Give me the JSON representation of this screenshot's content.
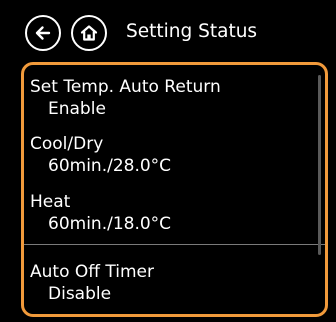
{
  "header": {
    "title": "Setting Status",
    "back_icon": "arrow-left-icon",
    "home_icon": "home-icon"
  },
  "colors": {
    "accent": "#f19a3b",
    "background": "#000000",
    "text": "#ffffff"
  },
  "settings": [
    {
      "label": "Set Temp. Auto Return",
      "value": "Enable"
    },
    {
      "label": "Cool/Dry",
      "value": "60min./28.0°C"
    },
    {
      "label": "Heat",
      "value": "60min./18.0°C"
    },
    {
      "label": "Auto Off Timer",
      "value": "Disable"
    }
  ]
}
